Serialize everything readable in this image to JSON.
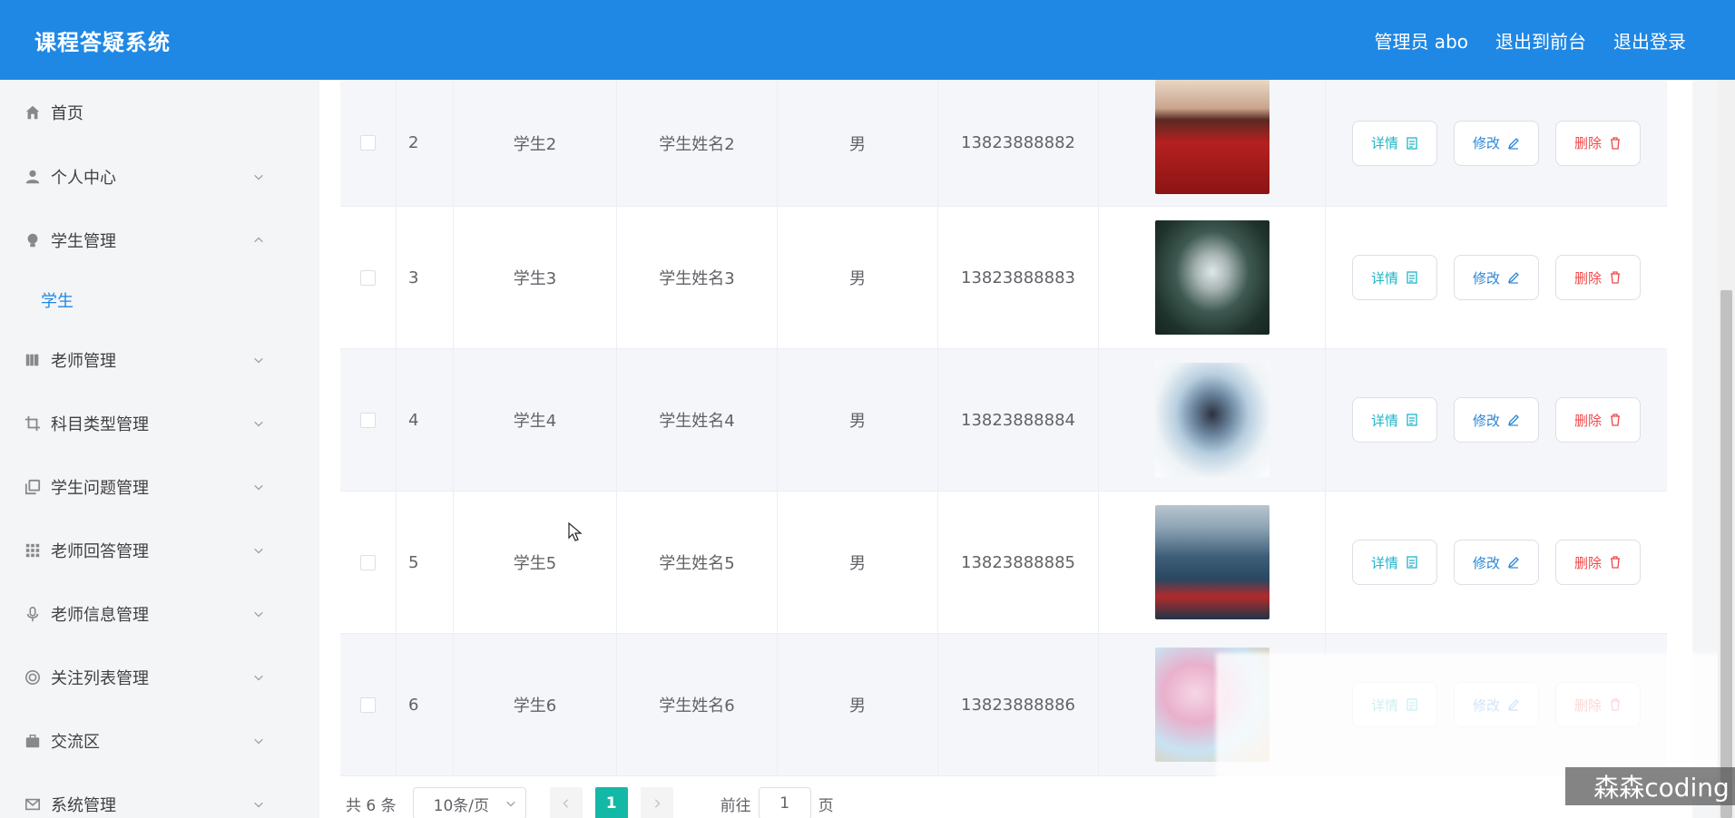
{
  "header": {
    "title": "课程答疑系统",
    "links": [
      "管理员 abo",
      "退出到前台",
      "退出登录"
    ]
  },
  "sidebar": {
    "items": [
      {
        "label": "首页",
        "icon": "home-icon",
        "expandable": false
      },
      {
        "label": "个人中心",
        "icon": "user-icon",
        "expandable": true
      },
      {
        "label": "学生管理",
        "icon": "bulb-icon",
        "expandable": true,
        "expanded": true
      },
      {
        "label": "老师管理",
        "icon": "books-icon",
        "expandable": true
      },
      {
        "label": "科目类型管理",
        "icon": "crop-icon",
        "expandable": true
      },
      {
        "label": "学生问题管理",
        "icon": "copy-icon",
        "expandable": true
      },
      {
        "label": "老师回答管理",
        "icon": "grid-icon",
        "expandable": true
      },
      {
        "label": "老师信息管理",
        "icon": "mic-icon",
        "expandable": true
      },
      {
        "label": "关注列表管理",
        "icon": "lifebuoy-icon",
        "expandable": true
      },
      {
        "label": "交流区",
        "icon": "briefcase-icon",
        "expandable": true
      },
      {
        "label": "系统管理",
        "icon": "mail-icon",
        "expandable": true
      }
    ],
    "subitem": "学生"
  },
  "table": {
    "rows": [
      {
        "idx": "2",
        "account": "学生2",
        "name": "学生姓名2",
        "sex": "男",
        "phone": "13823888882"
      },
      {
        "idx": "3",
        "account": "学生3",
        "name": "学生姓名3",
        "sex": "男",
        "phone": "13823888883"
      },
      {
        "idx": "4",
        "account": "学生4",
        "name": "学生姓名4",
        "sex": "男",
        "phone": "13823888884"
      },
      {
        "idx": "5",
        "account": "学生5",
        "name": "学生姓名5",
        "sex": "男",
        "phone": "13823888885"
      },
      {
        "idx": "6",
        "account": "学生6",
        "name": "学生姓名6",
        "sex": "男",
        "phone": "13823888886"
      }
    ],
    "actions": {
      "detail": "详情",
      "edit": "修改",
      "delete": "删除"
    }
  },
  "pagination": {
    "total": "共 6 条",
    "page_size": "10条/页",
    "current_page": "1",
    "goto_prefix": "前往",
    "goto_value": "1",
    "goto_suffix": "页"
  },
  "watermark": "森森coding",
  "colors": {
    "header": "#1f88e5",
    "accent": "#1f88e5",
    "page_active": "#14b8a6",
    "danger": "#f04848"
  }
}
